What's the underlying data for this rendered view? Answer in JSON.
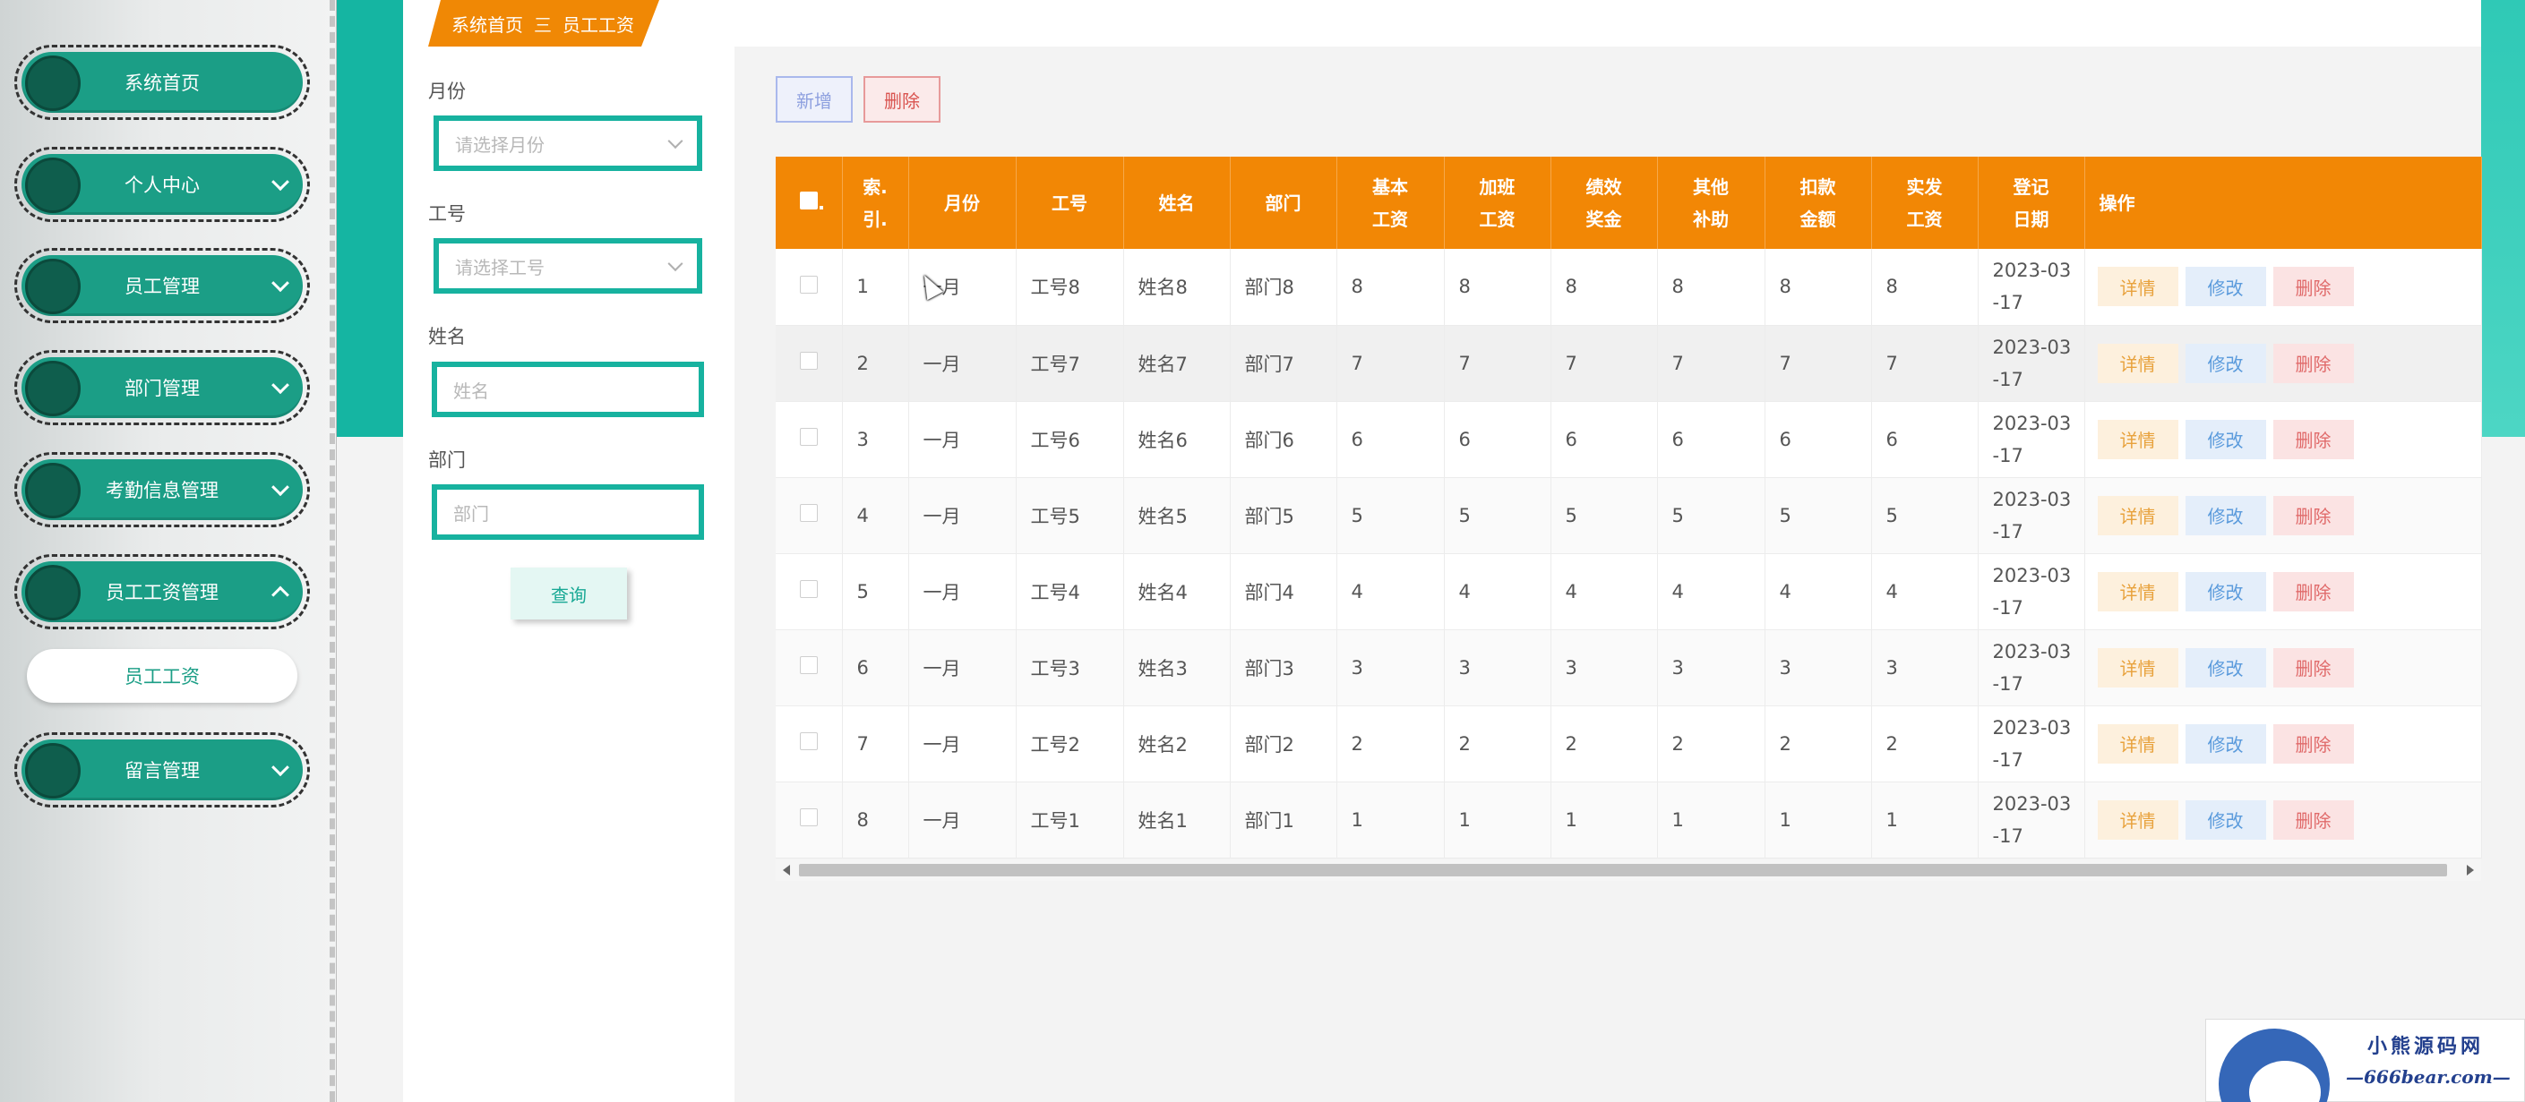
{
  "sidebar": {
    "items": [
      {
        "label": "系统首页"
      },
      {
        "label": "个人中心"
      },
      {
        "label": "员工管理"
      },
      {
        "label": "部门管理"
      },
      {
        "label": "考勤信息管理"
      },
      {
        "label": "员工工资管理"
      },
      {
        "label": "留言管理"
      }
    ],
    "submenu": {
      "label": "员工工资"
    }
  },
  "breadcrumb": {
    "home": "系统首页",
    "separator": "三",
    "current": "员工工资"
  },
  "search": {
    "month": {
      "label": "月份",
      "placeholder": "请选择月份"
    },
    "emp_no": {
      "label": "工号",
      "placeholder": "请选择工号"
    },
    "name": {
      "label": "姓名",
      "placeholder": "姓名"
    },
    "dept": {
      "label": "部门",
      "placeholder": "部门"
    },
    "query_label": "查询"
  },
  "toolbar": {
    "add_label": "新增",
    "delete_label": "删除"
  },
  "table": {
    "headers": {
      "index": "索引",
      "month": "月份",
      "emp_no": "工号",
      "name": "姓名",
      "dept": "部门",
      "base": "基本工资",
      "overtime": "加班工资",
      "bonus": "绩效奖金",
      "allowance": "其他补助",
      "deduct": "扣款金额",
      "actual": "实发工资",
      "date": "登记日期",
      "op": "操作"
    },
    "actions": {
      "detail": "详情",
      "edit": "修改",
      "remove": "删除"
    },
    "rows": [
      {
        "index": "1",
        "month": "一月",
        "emp_no": "工号8",
        "name": "姓名8",
        "dept": "部门8",
        "base": "8",
        "overtime": "8",
        "bonus": "8",
        "allowance": "8",
        "deduct": "8",
        "actual": "8",
        "date": "2023-03-17"
      },
      {
        "index": "2",
        "month": "一月",
        "emp_no": "工号7",
        "name": "姓名7",
        "dept": "部门7",
        "base": "7",
        "overtime": "7",
        "bonus": "7",
        "allowance": "7",
        "deduct": "7",
        "actual": "7",
        "date": "2023-03-17"
      },
      {
        "index": "3",
        "month": "一月",
        "emp_no": "工号6",
        "name": "姓名6",
        "dept": "部门6",
        "base": "6",
        "overtime": "6",
        "bonus": "6",
        "allowance": "6",
        "deduct": "6",
        "actual": "6",
        "date": "2023-03-17"
      },
      {
        "index": "4",
        "month": "一月",
        "emp_no": "工号5",
        "name": "姓名5",
        "dept": "部门5",
        "base": "5",
        "overtime": "5",
        "bonus": "5",
        "allowance": "5",
        "deduct": "5",
        "actual": "5",
        "date": "2023-03-17"
      },
      {
        "index": "5",
        "month": "一月",
        "emp_no": "工号4",
        "name": "姓名4",
        "dept": "部门4",
        "base": "4",
        "overtime": "4",
        "bonus": "4",
        "allowance": "4",
        "deduct": "4",
        "actual": "4",
        "date": "2023-03-17"
      },
      {
        "index": "6",
        "month": "一月",
        "emp_no": "工号3",
        "name": "姓名3",
        "dept": "部门3",
        "base": "3",
        "overtime": "3",
        "bonus": "3",
        "allowance": "3",
        "deduct": "3",
        "actual": "3",
        "date": "2023-03-17"
      },
      {
        "index": "7",
        "month": "一月",
        "emp_no": "工号2",
        "name": "姓名2",
        "dept": "部门2",
        "base": "2",
        "overtime": "2",
        "bonus": "2",
        "allowance": "2",
        "deduct": "2",
        "actual": "2",
        "date": "2023-03-17"
      },
      {
        "index": "8",
        "month": "一月",
        "emp_no": "工号1",
        "name": "姓名1",
        "dept": "部门1",
        "base": "1",
        "overtime": "1",
        "bonus": "1",
        "allowance": "1",
        "deduct": "1",
        "actual": "1",
        "date": "2023-03-17"
      }
    ]
  },
  "watermark": {
    "title": "小熊源码网",
    "subtitle": "—666bear.com—"
  },
  "colors": {
    "brand_teal": "#1b9e86",
    "accent_orange": "#f28705",
    "input_border": "#17b29f"
  },
  "icons": [
    "chevron-down-icon",
    "chevron-up-icon",
    "select-caret-icon",
    "checkbox-icon",
    "scroll-left-arrow-icon",
    "scroll-right-arrow-icon",
    "bear-logo-icon"
  ]
}
